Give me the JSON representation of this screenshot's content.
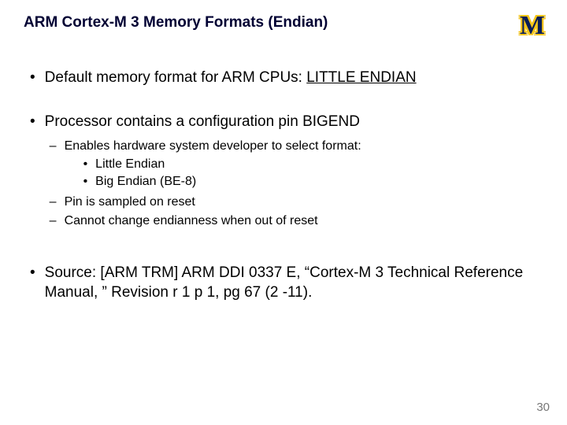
{
  "title": "ARM Cortex-M 3 Memory Formats (Endian)",
  "logo_letter": "M",
  "b1": {
    "t1": "Default memory format for ARM CPUs: ",
    "u1": "LITTLE ENDIAN"
  },
  "b2": {
    "t1": "Processor contains a configuration pin BIGEND",
    "s1": "Enables hardware system developer to select format:",
    "s1a": "Little Endian",
    "s1b": "Big Endian (BE-8)",
    "s2": "Pin is sampled on reset",
    "s3": "Cannot change endianness when out of reset"
  },
  "b3": {
    "t1": "Source: [ARM TRM] ARM DDI 0337 E, “Cortex-M 3 Technical Reference Manual, ” Revision r 1 p 1, pg 67 (2 -11)."
  },
  "page_number": "30"
}
